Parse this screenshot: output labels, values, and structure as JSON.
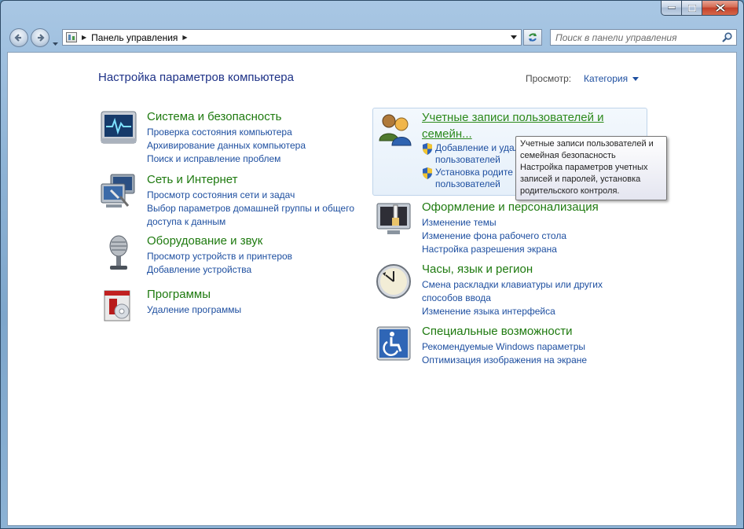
{
  "window": {
    "address": "Панель управления",
    "search_placeholder": "Поиск в панели управления"
  },
  "header": {
    "title": "Настройка параметров компьютера",
    "view_label": "Просмотр:",
    "view_value": "Категория"
  },
  "left_categories": [
    {
      "title": "Система и безопасность",
      "icon": "system-security-icon",
      "links": [
        "Проверка состояния компьютера",
        "Архивирование данных компьютера",
        "Поиск и исправление проблем"
      ]
    },
    {
      "title": "Сеть и Интернет",
      "icon": "network-icon",
      "links": [
        "Просмотр состояния сети и задач",
        "Выбор параметров домашней группы и общего",
        "доступа к данным"
      ]
    },
    {
      "title": "Оборудование и звук",
      "icon": "microphone-icon",
      "links": [
        "Просмотр устройств и принтеров",
        "Добавление устройства"
      ]
    },
    {
      "title": "Программы",
      "icon": "programs-icon",
      "links": [
        "Удаление программы"
      ]
    }
  ],
  "user_accounts": {
    "title_line1": "Учетные записи пользователей и",
    "title_line2": "семейн...",
    "icon": "users-icon",
    "links": [
      {
        "line1": "Добавление и удал",
        "line2": "пользователей"
      },
      {
        "line1": "Установка родите",
        "line2": "пользователей"
      }
    ]
  },
  "right_categories": [
    {
      "title": "Оформление и персонализация",
      "icon": "appearance-icon",
      "links": [
        "Изменение темы",
        "Изменение фона рабочего стола",
        "Настройка разрешения экрана"
      ]
    },
    {
      "title": "Часы, язык и регион",
      "icon": "clock-icon",
      "links": [
        "Смена раскладки клавиатуры или других",
        "способов ввода",
        "Изменение языка интерфейса"
      ]
    },
    {
      "title": "Специальные возможности",
      "icon": "accessibility-icon",
      "links": [
        "Рекомендуемые Windows параметры",
        "Оптимизация изображения на экране"
      ]
    }
  ],
  "tooltip": {
    "lines": [
      "Учетные записи пользователей и",
      "семейная безопасность",
      "Настройка параметров учетных",
      "записей и паролей, установка",
      "родительского контроля."
    ]
  }
}
